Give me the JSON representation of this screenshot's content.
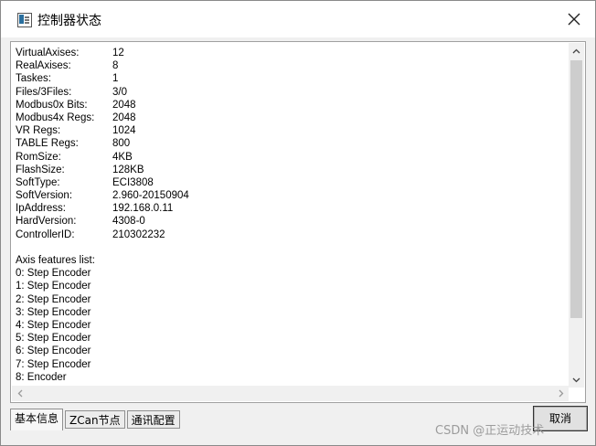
{
  "window": {
    "title": "控制器状态"
  },
  "info": [
    {
      "label": "VirtualAxises:",
      "value": "12"
    },
    {
      "label": "RealAxises:",
      "value": "8"
    },
    {
      "label": "Taskes:",
      "value": "1"
    },
    {
      "label": "Files/3Files:",
      "value": "3/0"
    },
    {
      "label": "Modbus0x Bits:",
      "value": "2048"
    },
    {
      "label": "Modbus4x Regs:",
      "value": "2048"
    },
    {
      "label": "VR Regs:",
      "value": "1024"
    },
    {
      "label": "TABLE Regs:",
      "value": "800"
    },
    {
      "label": "RomSize:",
      "value": "4KB"
    },
    {
      "label": "FlashSize:",
      "value": "128KB"
    },
    {
      "label": "SoftType:",
      "value": "ECI3808"
    },
    {
      "label": "SoftVersion:",
      "value": "2.960-20150904"
    },
    {
      "label": "IpAddress:",
      "value": "192.168.0.11"
    },
    {
      "label": "HardVersion:",
      "value": "4308-0"
    },
    {
      "label": "ControllerID:",
      "value": "210302232"
    }
  ],
  "axis_section": {
    "heading": "Axis features list:",
    "items": [
      "0: Step Encoder",
      "1: Step Encoder",
      "2: Step Encoder",
      "3: Step Encoder",
      "4: Step Encoder",
      "5: Step Encoder",
      "6: Step Encoder",
      "7: Step Encoder",
      "8: Encoder"
    ]
  },
  "tabs": [
    {
      "label": "基本信息",
      "active": true
    },
    {
      "label": "ZCan节点",
      "active": false
    },
    {
      "label": "通讯配置",
      "active": false
    }
  ],
  "buttons": {
    "cancel": "取消"
  },
  "watermark": "CSDN @正运动技术",
  "icons": {
    "app": "app-window-icon",
    "close": "close-icon",
    "scroll_up": "chevron-up-icon",
    "scroll_down": "chevron-down-icon",
    "scroll_left": "chevron-left-icon",
    "scroll_right": "chevron-right-icon"
  }
}
